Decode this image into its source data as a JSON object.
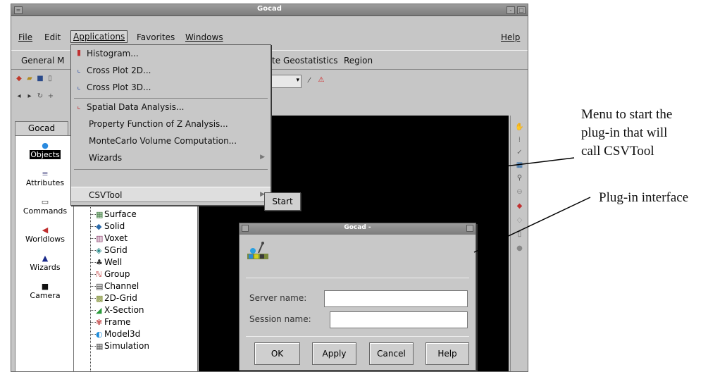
{
  "window": {
    "title": "Gocad"
  },
  "menubar": {
    "file": "File",
    "edit": "Edit",
    "applications": "Applications",
    "favorites": "Favorites",
    "windows": "Windows",
    "help": "Help"
  },
  "toolbar2": {
    "general": "General M",
    "geostatistics_partial": "te",
    "geostatistics": "Geostatistics",
    "region": "Region"
  },
  "applications_menu": {
    "items": [
      {
        "label": "Histogram...",
        "icon": "histogram-icon"
      },
      {
        "label": "Cross Plot 2D...",
        "icon": "cross-plot-2d-icon"
      },
      {
        "label": "Cross Plot 3D...",
        "icon": "cross-plot-3d-icon"
      },
      {
        "label": "Spatial Data Analysis...",
        "icon": "spatial-analysis-icon"
      },
      {
        "label": "Property Function of Z Analysis..."
      },
      {
        "label": "MonteCarlo Volume Computation..."
      },
      {
        "label": "Wizards",
        "submenu": true
      },
      {
        "label": "CSVTool",
        "submenu": true,
        "highlighted": true
      }
    ]
  },
  "csvtool_submenu": {
    "start": "Start"
  },
  "left_panel": {
    "tab": "Gocad",
    "items": [
      {
        "label": "Objects",
        "selected": true
      },
      {
        "label": "Attributes"
      },
      {
        "label": "Commands"
      },
      {
        "label": "Worldlows"
      },
      {
        "label": "Wizards"
      },
      {
        "label": "Camera"
      }
    ]
  },
  "tree": {
    "items": [
      "Surface",
      "Solid",
      "Voxet",
      "SGrid",
      "Well",
      "Group",
      "Channel",
      "2D-Grid",
      "X-Section",
      "Frame",
      "Model3d",
      "Simulation"
    ]
  },
  "dialog": {
    "title": "Gocad -",
    "server_label": "Server name:",
    "server_value": "",
    "session_label": "Session name:",
    "session_value": "",
    "buttons": {
      "ok": "OK",
      "apply": "Apply",
      "cancel": "Cancel",
      "help": "Help"
    }
  },
  "annotations": {
    "menu_note": [
      "Menu to start the",
      "plug-in that will",
      "call CSVTool"
    ],
    "plugin_note": "Plug-in interface"
  }
}
